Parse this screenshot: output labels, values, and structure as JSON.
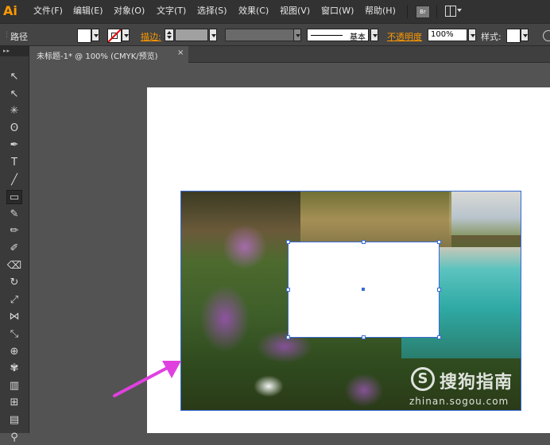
{
  "app": {
    "logo": "Ai"
  },
  "menu": [
    "文件(F)",
    "编辑(E)",
    "对象(O)",
    "文字(T)",
    "选择(S)",
    "效果(C)",
    "视图(V)",
    "窗口(W)",
    "帮助(H)"
  ],
  "menu_extra": {
    "bridge": "Br"
  },
  "control_bar": {
    "path_label": "路径",
    "stroke_label": "描边:",
    "profile_value": "基本",
    "opacity_label": "不透明度",
    "opacity_value": "100%",
    "style_label": "样式:"
  },
  "document": {
    "tab_title": "未标题-1* @ 100% (CMYK/预览)",
    "close": "×"
  },
  "tools": [
    "selection-tool",
    "direct-selection-tool",
    "magic-wand-tool",
    "lasso-tool",
    "pen-tool",
    "type-tool",
    "line-segment-tool",
    "rectangle-tool",
    "paintbrush-tool",
    "pencil-tool",
    "blob-brush-tool",
    "eraser-tool",
    "rotate-tool",
    "scale-tool",
    "width-tool",
    "free-transform-tool",
    "shape-builder-tool",
    "symbol-sprayer-tool",
    "column-graph-tool",
    "mesh-tool",
    "gradient-tool",
    "eyedropper-tool"
  ],
  "tool_glyphs": [
    "↖",
    "↖",
    "✳",
    "ʘ",
    "✒",
    "T",
    "╱",
    "▭",
    "✎",
    "✏",
    "✐",
    "⌫",
    "↻",
    "⤢",
    "⋈",
    "⤡",
    "⊕",
    "✾",
    "▥",
    "⊞",
    "▤",
    "⚲"
  ],
  "selected_tool": "rectangle-tool",
  "watermark": {
    "name": "搜狗指南",
    "url": "zhinan.sogou.com",
    "logo_letter": "S"
  },
  "colors": {
    "accent": "#ff9a00",
    "selection": "#3a6bd6",
    "arrow": "#e040e0"
  }
}
